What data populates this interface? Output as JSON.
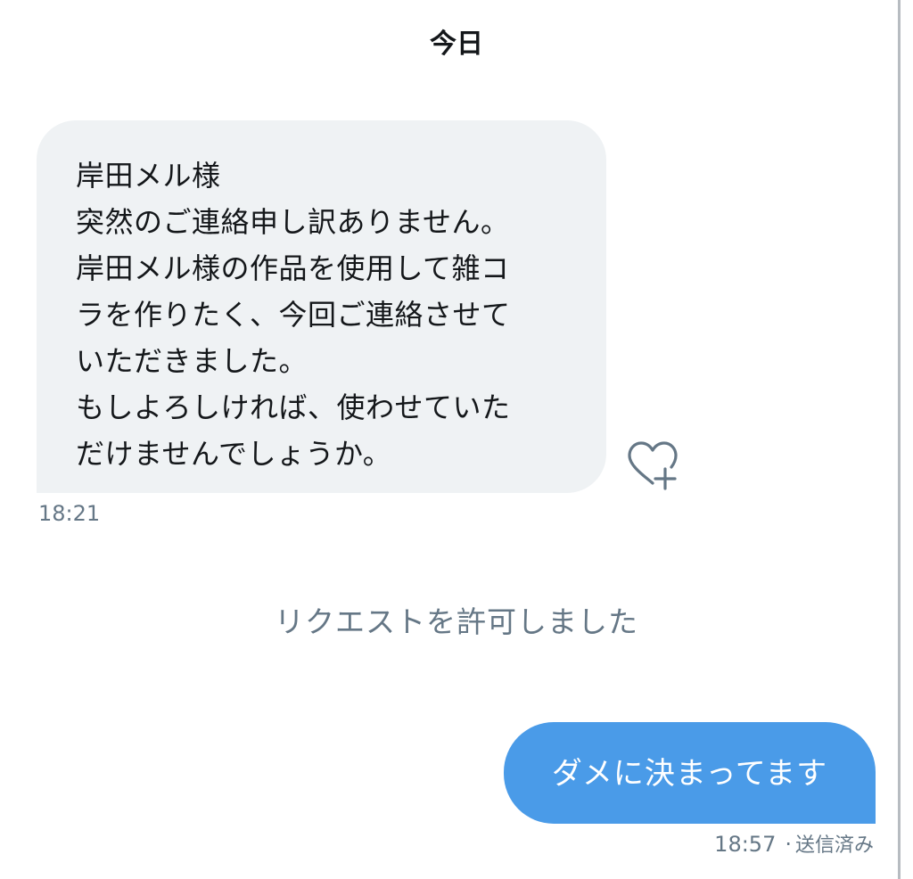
{
  "date_header": "今日",
  "incoming": {
    "text": "岸田メル様\n突然のご連絡申し訳ありません。\n岸田メル様の作品を使用して雑コ\nラを作りたく、今回ご連絡させて\nいただきました。\nもしよろしければ、使わせていた\nだけませんでしょうか。",
    "time": "18:21",
    "react_icon": "heart-plus-icon"
  },
  "system_message": "リクエストを許可しました",
  "outgoing": {
    "text": "ダメに決まってます",
    "time": "18:57",
    "separator": "·",
    "status": "送信済み"
  },
  "colors": {
    "incoming_bubble": "#eff2f4",
    "outgoing_bubble": "#4a9be8",
    "secondary_text": "#657786",
    "primary_text": "#14171a"
  }
}
